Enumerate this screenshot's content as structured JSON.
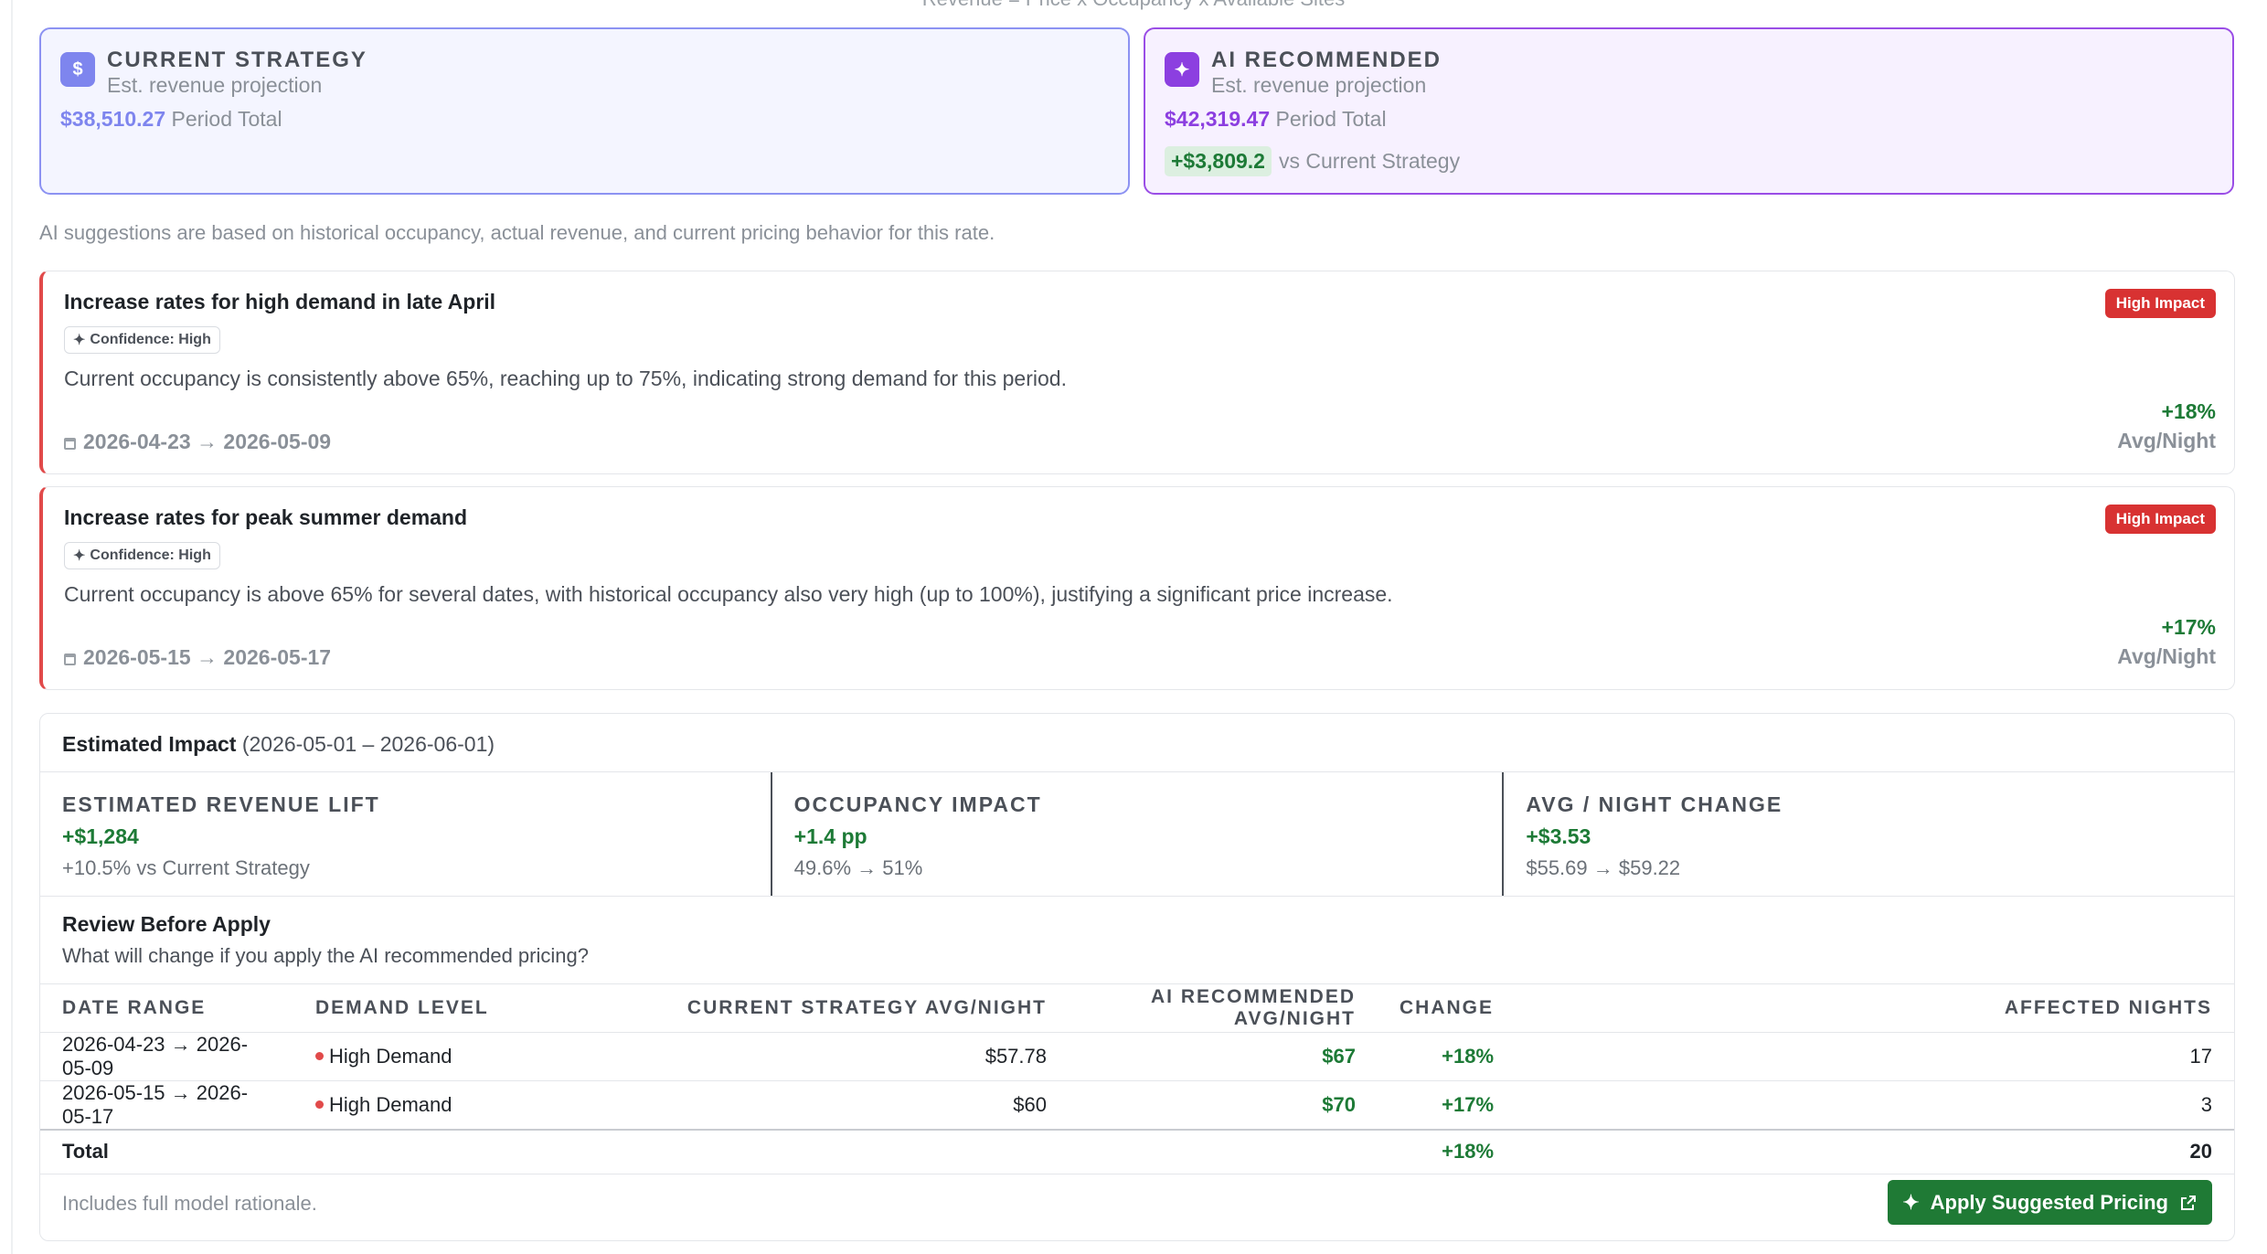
{
  "formula": "Revenue = Price x Occupancy x Available Sites",
  "current_card": {
    "icon": "dollar-icon",
    "icon_glyph": "$",
    "title": "CURRENT STRATEGY",
    "subtitle": "Est. revenue projection",
    "amount": "$38,510.27",
    "amount_label": "Period Total"
  },
  "ai_card": {
    "icon": "sparkle-icon",
    "icon_glyph": "✦",
    "title": "AI RECOMMENDED",
    "subtitle": "Est. revenue projection",
    "amount": "$42,319.47",
    "amount_label": "Period Total",
    "delta": "+$3,809.2",
    "delta_label": "vs Current Strategy"
  },
  "note": "AI suggestions are based on historical occupancy, actual revenue, and current pricing behavior for this rate.",
  "suggestions": [
    {
      "title": "Increase rates for high demand in late April",
      "confidence": "Confidence: High",
      "description": "Current occupancy is consistently above 65%, reaching up to 75%, indicating strong demand for this period.",
      "dates": "2026-04-23 → 2026-05-09",
      "badge": "High Impact",
      "pct": "+18%",
      "unit": "Avg/Night"
    },
    {
      "title": "Increase rates for peak summer demand",
      "confidence": "Confidence: High",
      "description": "Current occupancy is above 65% for several dates, with historical occupancy also very high (up to 100%), justifying a significant price increase.",
      "dates": "2026-05-15 → 2026-05-17",
      "badge": "High Impact",
      "pct": "+17%",
      "unit": "Avg/Night"
    }
  ],
  "impact": {
    "title": "Estimated Impact",
    "range": "(2026-05-01 – 2026-06-01)",
    "metrics": [
      {
        "label": "ESTIMATED REVENUE LIFT",
        "value": "+$1,284",
        "sub": "+10.5% vs Current Strategy"
      },
      {
        "label": "OCCUPANCY IMPACT",
        "value": "+1.4 pp",
        "sub": "49.6% → 51%"
      },
      {
        "label": "AVG / NIGHT CHANGE",
        "value": "+$3.53",
        "sub": "$55.69 → $59.22"
      }
    ],
    "review_title": "Review Before Apply",
    "review_sub": "What will change if you apply the AI recommended pricing?",
    "table": {
      "headers": [
        "DATE RANGE",
        "DEMAND LEVEL",
        "CURRENT STRATEGY AVG/NIGHT",
        "AI RECOMMENDED AVG/NIGHT",
        "CHANGE",
        "AFFECTED NIGHTS"
      ],
      "rows": [
        {
          "range": "2026-04-23 → 2026-05-09",
          "demand": "High Demand",
          "current": "$57.78",
          "ai": "$67",
          "change": "+18%",
          "nights": "17"
        },
        {
          "range": "2026-05-15 → 2026-05-17",
          "demand": "High Demand",
          "current": "$60",
          "ai": "$70",
          "change": "+17%",
          "nights": "3"
        }
      ],
      "total": {
        "label": "Total",
        "change": "+18%",
        "nights": "20"
      }
    },
    "footer_note": "Includes full model rationale.",
    "apply_label": "Apply Suggested Pricing"
  },
  "colors": {
    "current_accent": "#7e85ee",
    "ai_accent": "#8c3fe0",
    "positive": "#1d7a36",
    "high_impact": "#d83232",
    "apply_button": "#1f7a35"
  }
}
